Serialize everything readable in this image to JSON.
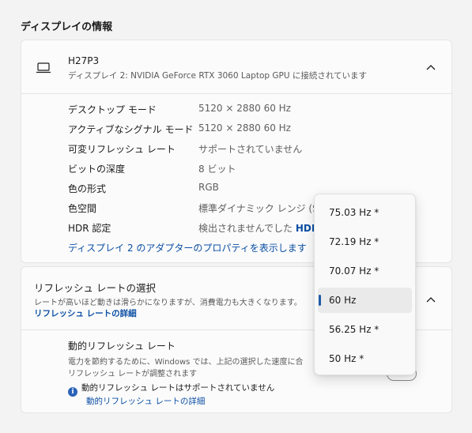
{
  "section_title": "ディスプレイの情報",
  "display": {
    "name": "H27P3",
    "description": "ディスプレイ 2: NVIDIA GeForce RTX 3060 Laptop GPU に接続されています",
    "icon": "laptop-icon"
  },
  "info_rows": [
    {
      "label": "デスクトップ モード",
      "value": "5120 × 2880 60 Hz"
    },
    {
      "label": "アクティブなシグナル モード",
      "value": "5120 × 2880 60 Hz"
    },
    {
      "label": "可変リフレッシュ レート",
      "value": "サポートされていません"
    },
    {
      "label": "ビットの深度",
      "value": "8 ビット"
    },
    {
      "label": "色の形式",
      "value": "RGB"
    },
    {
      "label": "色空間",
      "value": "標準ダイナミック レンジ (SD"
    },
    {
      "label": "HDR 認定",
      "value": "検出されませんでした",
      "link": "HDR"
    }
  ],
  "properties_link": "ディスプレイ 2 のアダプターのプロパティを表示します",
  "refresh_rate": {
    "title": "リフレッシュ レートの選択",
    "description": "レートが高いほど動きは滑らかになりますが、消費電力も大きくなります。",
    "link": "リフレッシュ レートの詳細"
  },
  "dynamic_refresh": {
    "title": "動的リフレッシュ レート",
    "desc_line1": "電力を節約するために、Windows では、上記の選択した速度に合",
    "desc_line2": "リフレッシュ レートが調整されます",
    "note": "動的リフレッシュ レートはサポートされていません",
    "note_link": "動的リフレッシュ レートの詳細"
  },
  "dropdown": {
    "options": [
      "75.03 Hz *",
      "72.19 Hz *",
      "70.07 Hz *",
      "60 Hz",
      "56.25 Hz *",
      "50 Hz *"
    ],
    "selected": "60 Hz"
  },
  "colors": {
    "accent": "#0b4fa3",
    "background": "#f3f3f3",
    "card": "#fbfbfb"
  }
}
